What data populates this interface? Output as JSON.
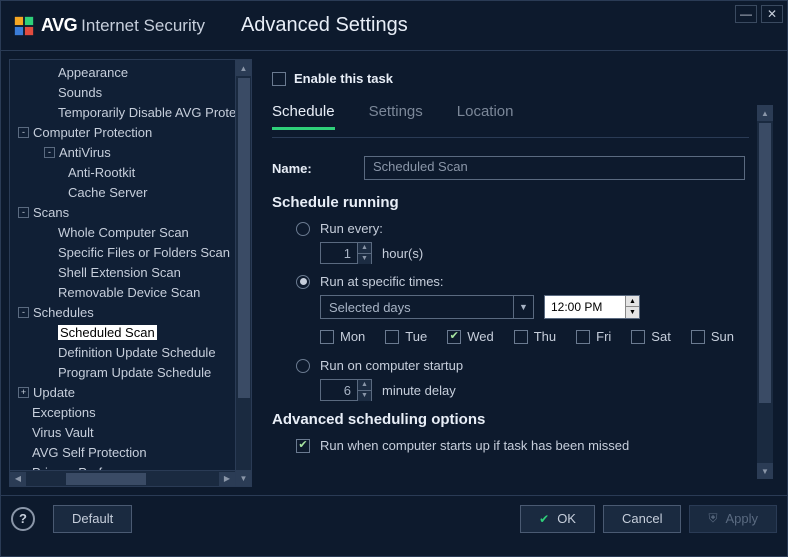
{
  "header": {
    "logo_brand": "AVG",
    "logo_product": "Internet Security",
    "title": "Advanced Settings"
  },
  "sidebar": {
    "items": [
      {
        "label": "Appearance",
        "level": 2,
        "exp": null,
        "selected": false
      },
      {
        "label": "Sounds",
        "level": 2,
        "exp": null,
        "selected": false
      },
      {
        "label": "Temporarily Disable AVG Protection",
        "level": 2,
        "exp": null,
        "selected": false
      },
      {
        "label": "Computer Protection",
        "level": 1,
        "exp": "-",
        "selected": false
      },
      {
        "label": "AntiVirus",
        "level": 2,
        "exp": "-",
        "selected": false
      },
      {
        "label": "Anti-Rootkit",
        "level": 3,
        "exp": null,
        "selected": false
      },
      {
        "label": "Cache Server",
        "level": 3,
        "exp": null,
        "selected": false
      },
      {
        "label": "Scans",
        "level": 1,
        "exp": "-",
        "selected": false
      },
      {
        "label": "Whole Computer Scan",
        "level": 2,
        "exp": null,
        "selected": false
      },
      {
        "label": "Specific Files or Folders Scan",
        "level": 2,
        "exp": null,
        "selected": false
      },
      {
        "label": "Shell Extension Scan",
        "level": 2,
        "exp": null,
        "selected": false
      },
      {
        "label": "Removable Device Scan",
        "level": 2,
        "exp": null,
        "selected": false
      },
      {
        "label": "Schedules",
        "level": 1,
        "exp": "-",
        "selected": false
      },
      {
        "label": "Scheduled Scan",
        "level": 2,
        "exp": null,
        "selected": true
      },
      {
        "label": "Definition Update Schedule",
        "level": 2,
        "exp": null,
        "selected": false
      },
      {
        "label": "Program Update Schedule",
        "level": 2,
        "exp": null,
        "selected": false
      },
      {
        "label": "Update",
        "level": 1,
        "exp": "+",
        "selected": false
      },
      {
        "label": "Exceptions",
        "level": 1,
        "exp": null,
        "selected": false
      },
      {
        "label": "Virus Vault",
        "level": 1,
        "exp": null,
        "selected": false
      },
      {
        "label": "AVG Self Protection",
        "level": 1,
        "exp": null,
        "selected": false
      },
      {
        "label": "Privacy Preferences",
        "level": 1,
        "exp": null,
        "selected": false
      }
    ]
  },
  "content": {
    "enable_label": "Enable this task",
    "enable_checked": false,
    "tabs": {
      "schedule": "Schedule",
      "settings": "Settings",
      "location": "Location"
    },
    "name_label": "Name:",
    "name_value": "Scheduled Scan",
    "schedule_running": "Schedule running",
    "run_every": {
      "label": "Run every:",
      "value": "1",
      "unit": "hour(s)",
      "selected": false
    },
    "run_specific": {
      "label": "Run at specific times:",
      "selected": true,
      "dropdown": "Selected days",
      "time": "12:00 PM"
    },
    "days": {
      "mon": "Mon",
      "tue": "Tue",
      "wed": "Wed",
      "thu": "Thu",
      "fri": "Fri",
      "sat": "Sat",
      "sun": "Sun",
      "checked": "wed"
    },
    "run_startup": {
      "label": "Run on computer startup",
      "selected": false,
      "value": "6",
      "unit": "minute delay"
    },
    "advanced_title": "Advanced scheduling options",
    "advanced_opt1": "Run when computer starts up if task has been missed",
    "advanced_opt1_checked": true
  },
  "footer": {
    "default": "Default",
    "ok": "OK",
    "cancel": "Cancel",
    "apply": "Apply"
  }
}
